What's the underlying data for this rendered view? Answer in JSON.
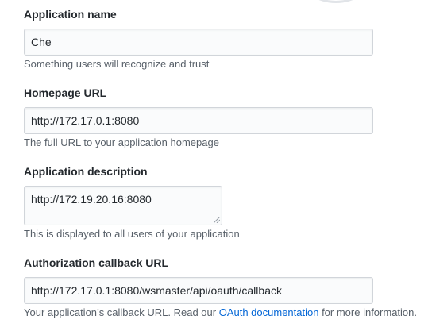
{
  "form": {
    "app_name": {
      "label": "Application name",
      "value": "Che",
      "note": "Something users will recognize and trust"
    },
    "homepage": {
      "label": "Homepage URL",
      "value": "http://172.17.0.1:8080",
      "note": "The full URL to your application homepage"
    },
    "description": {
      "label": "Application description",
      "value": "http://172.19.20.16:8080",
      "note": "This is displayed to all users of your application"
    },
    "callback": {
      "label": "Authorization callback URL",
      "value": "http://172.17.0.1:8080/wsmaster/api/oauth/callback",
      "note_prefix": "Your application’s callback URL. Read our ",
      "note_link": "OAuth documentation",
      "note_suffix": " for more information."
    }
  },
  "colors": {
    "link": "#0366d6",
    "muted": "#586069",
    "border": "#d1d5da"
  }
}
